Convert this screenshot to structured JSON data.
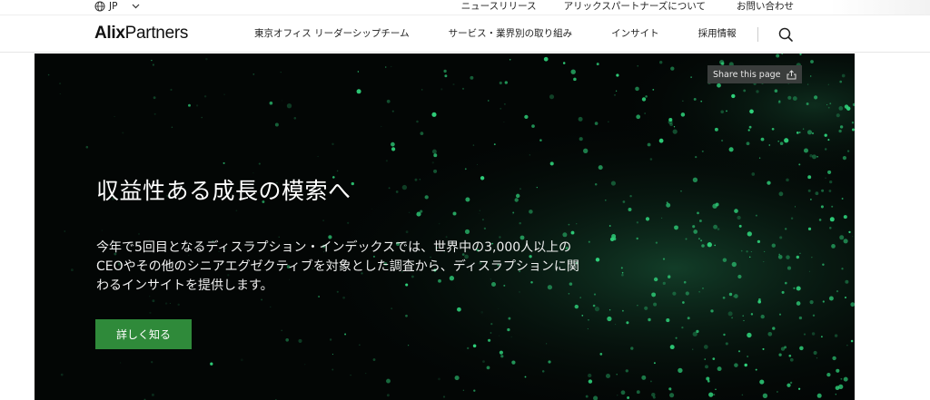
{
  "utility": {
    "language": "JP",
    "links": [
      "ニュースリリース",
      "アリックスパートナーズについて",
      "お問い合わせ"
    ]
  },
  "header": {
    "logo_bold": "Alix",
    "logo_light": "Partners",
    "nav": [
      "東京オフィス リーダーシップチーム",
      "サービス・業界別の取り組み",
      "インサイト",
      "採用情報"
    ]
  },
  "hero": {
    "share_label": "Share this page",
    "title": "収益性ある成長の模索へ",
    "description": "今年で5回目となるディスラプション・インデックスでは、世界中の3,000人以上のCEOやその他のシニアエグゼクティブを対象とした調査から、ディスラプションに関わるインサイトを提供します。",
    "cta_label": "詳しく知る"
  },
  "colors": {
    "cta_green": "#2f8a3a",
    "hero_bg": "#030605",
    "particle_green": "#2fd07a"
  },
  "icons": {
    "globe": "globe-icon",
    "chevron": "chevron-down-icon",
    "search": "search-icon",
    "share": "share-icon"
  }
}
